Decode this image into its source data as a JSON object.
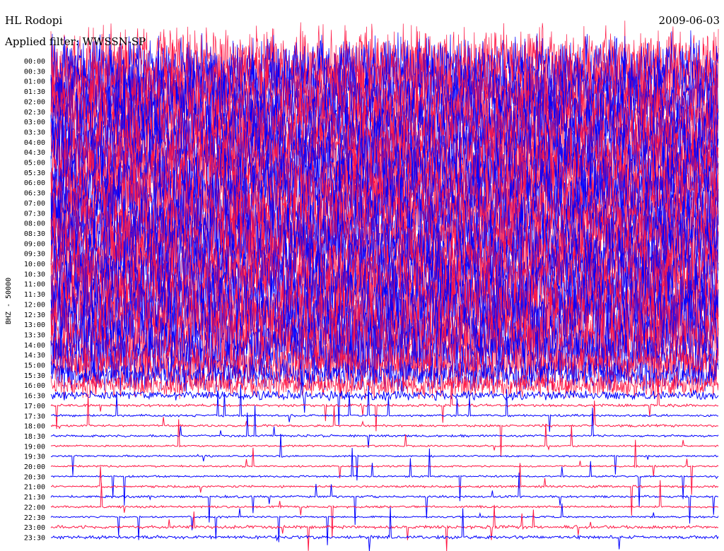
{
  "header": {
    "station": "HL Rodopi",
    "filter": "Applied filter: WWSSN-SP",
    "date": "2009-06-03"
  },
  "chart_data": {
    "type": "line",
    "title": "HL Rodopi",
    "subtitle": "Applied filter: WWSSN-SP",
    "date": "2009-06-03",
    "channel_label": "BHZ - 50000",
    "rows": [
      "00:00",
      "00:30",
      "01:00",
      "01:30",
      "02:00",
      "02:30",
      "03:00",
      "03:30",
      "04:00",
      "04:30",
      "05:00",
      "05:30",
      "06:00",
      "06:30",
      "07:00",
      "07:30",
      "08:00",
      "08:30",
      "09:00",
      "09:30",
      "10:00",
      "10:30",
      "11:00",
      "11:30",
      "12:00",
      "12:30",
      "13:00",
      "13:30",
      "14:00",
      "14:30",
      "15:00",
      "15:30",
      "16:00",
      "16:30",
      "17:00",
      "17:30",
      "18:00",
      "18:30",
      "19:00",
      "19:30",
      "20:00",
      "20:30",
      "21:00",
      "21:30",
      "22:00",
      "22:30",
      "23:00",
      "23:30"
    ],
    "row_colors": [
      "#ff1744",
      "#0000ff"
    ],
    "noise_level": [
      1.0,
      1.0,
      1.0,
      1.0,
      1.0,
      1.0,
      1.0,
      1.0,
      1.0,
      1.0,
      1.0,
      1.0,
      1.0,
      1.0,
      1.0,
      1.0,
      1.0,
      1.0,
      1.0,
      1.0,
      1.0,
      1.0,
      1.0,
      1.0,
      1.0,
      1.0,
      1.0,
      1.0,
      1.0,
      0.8,
      0.6,
      0.45,
      0.35,
      0.2,
      0.06,
      0.05,
      0.05,
      0.05,
      0.04,
      0.04,
      0.04,
      0.04,
      0.05,
      0.05,
      0.05,
      0.04,
      0.07,
      0.07
    ],
    "grid": false,
    "legend": "none"
  }
}
